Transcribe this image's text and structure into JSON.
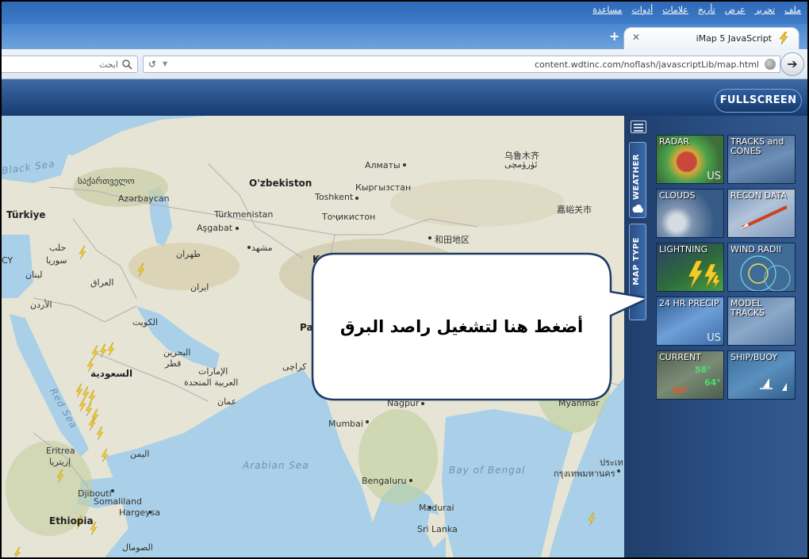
{
  "menubar": {
    "items": [
      "ملف",
      "تحرير",
      "عرض",
      "تأريخ",
      "علامات",
      "أدوات",
      "مساعدة"
    ]
  },
  "tab": {
    "title": "iMap 5 JavaScript",
    "close_glyph": "✕",
    "new_tab_glyph": "+"
  },
  "navbar": {
    "search_placeholder": "ابحث",
    "url": "content.wdtinc.com/noflash/javascriptLib/map.html",
    "reload_glyph": "↺",
    "dropdown_glyph": "▼",
    "go_glyph": "➔"
  },
  "app": {
    "fullscreen_label": "FULLSCREEN"
  },
  "sidepanel": {
    "weather_tab": "WEATHER",
    "maptype_tab": "MAP TYPE",
    "tiles": [
      {
        "label": "RADAR",
        "badge": "US"
      },
      {
        "label": "TRACKS and CONES",
        "badge": ""
      },
      {
        "label": "CLOUDS",
        "badge": ""
      },
      {
        "label": "RECON DATA",
        "badge": ""
      },
      {
        "label": "LIGHTNING",
        "badge": ""
      },
      {
        "label": "WIND RADII",
        "badge": ""
      },
      {
        "label": "24 HR PRECIP",
        "badge": "US"
      },
      {
        "label": "MODEL TRACKS",
        "badge": ""
      },
      {
        "label": "CURRENT",
        "badge": ""
      },
      {
        "label": "SHIP/BUOY",
        "badge": ""
      }
    ],
    "current_temps": [
      "58°",
      "64°",
      "80°"
    ]
  },
  "callout": {
    "text": "أضغط هنا لتشغيل راصد البرق"
  },
  "map": {
    "labels": [
      "Black Sea",
      "საქართველო",
      "Azərbaycan",
      "Türkiye",
      "Türkmenistan",
      "Aşgabat",
      "O'zbekiston",
      "Toshkent",
      "Алматы",
      "Кыргызстан",
      "Тоҷикистон",
      "乌鲁木齐",
      "ئۈرۈمچى",
      "嘉峪关市",
      "和田地区",
      "حلب",
      "سوريا",
      "لبنان",
      "الأردن",
      "العراق",
      "طهران",
      "مشهد",
      "ايران",
      "الكويت",
      "البحرين",
      "قطر",
      "الإمارات",
      "العربية المتحدة",
      "عمان",
      "السعودية",
      "كراچی",
      "Pa",
      "Kab",
      "Red Sea",
      "Eritrea",
      "إريتريا",
      "Djibouti",
      "Ethiopia",
      "Somaliland",
      "Hargeysa",
      "الصومال",
      "اليمن",
      "Arabian Sea",
      "Mumbai",
      "Nagpur",
      "Bengaluru",
      "Madurai",
      "Sri Lanka",
      "Bay of Bengal",
      "Myanmar",
      "กรุงเทพมหานคร",
      "ประเท",
      "CY"
    ]
  }
}
